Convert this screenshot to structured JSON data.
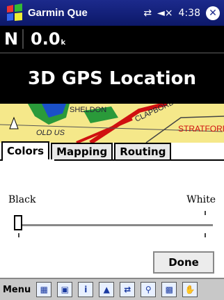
{
  "title_bar": {
    "app_title": "Garmin Que",
    "time": "4:38",
    "connectivity_icon": "sync-arrows-icon",
    "volume_icon": "speaker-muted-icon",
    "close_icon": "close-icon",
    "close_glyph": "✕"
  },
  "heading_bar": {
    "direction": "N",
    "speed": "0.0",
    "speed_unit": "k"
  },
  "banner": {
    "text": "3D GPS Location"
  },
  "map": {
    "labels": [
      "SHELDON",
      "OLD US",
      "CLAPBORD",
      "STRATFORD"
    ]
  },
  "tabs": [
    {
      "label": "Colors",
      "active": true
    },
    {
      "label": "Mapping",
      "active": false
    },
    {
      "label": "Routing",
      "active": false
    }
  ],
  "panel": {
    "left_label": "Black",
    "right_label": "White",
    "slider_value": 0.0,
    "done_label": "Done"
  },
  "toolbar": {
    "menu_label": "Menu",
    "tools": [
      "calendar-icon",
      "contacts-icon",
      "info-icon",
      "triangle-icon",
      "route-icon",
      "binoculars-icon",
      "map-icon",
      "hand-icon"
    ],
    "tool_glyphs": [
      "▦",
      "▣",
      "i",
      "▲",
      "⇄",
      "⚲",
      "▩",
      "✋"
    ]
  },
  "colors": {
    "title_bar_bg": "#1c2a8c",
    "map_bg": "#f5e88a",
    "map_road": "#d01010",
    "map_water": "#1a50c8",
    "map_green": "#2a9a3a"
  }
}
